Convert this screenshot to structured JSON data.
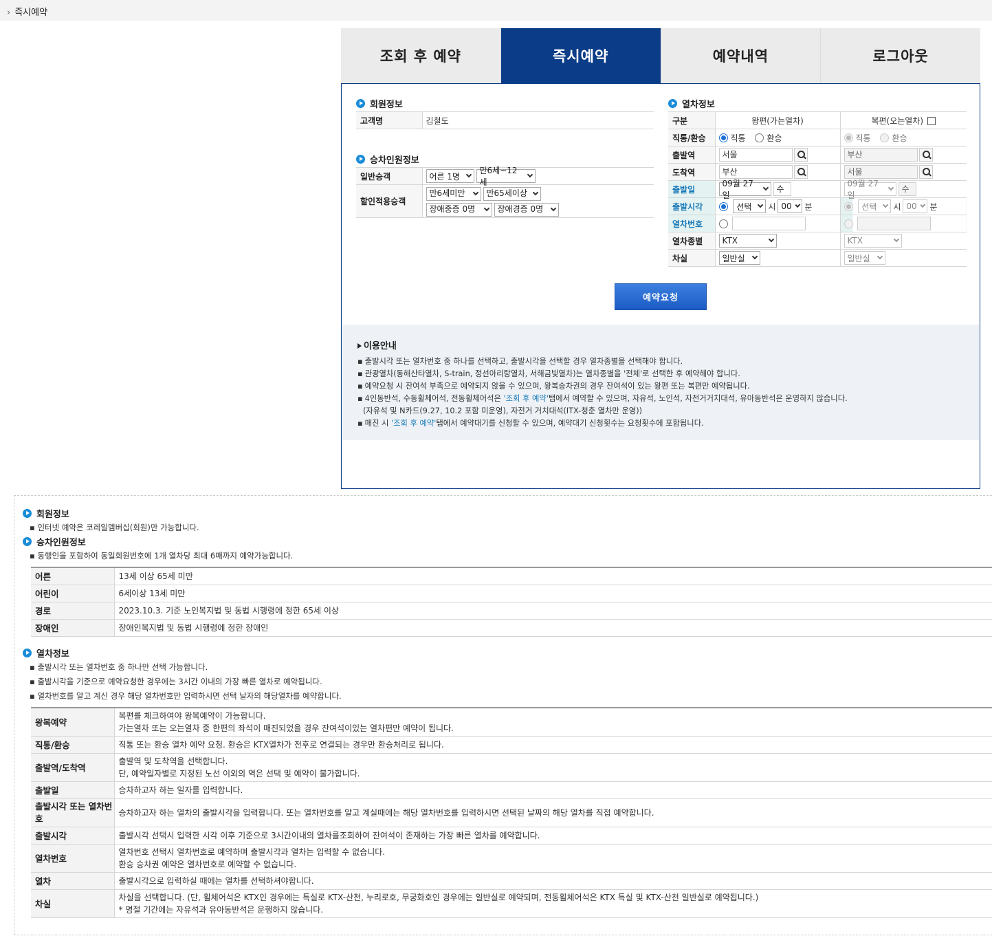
{
  "breadcrumb": {
    "label": "즉시예약"
  },
  "tabs": [
    "조회 후 예약",
    "즉시예약",
    "예약내역",
    "로그아웃"
  ],
  "member": {
    "title": "회원정보",
    "name_label": "고객명",
    "name_value": "김철도"
  },
  "passengers": {
    "title": "승차인원정보",
    "general_label": "일반승객",
    "general_adult": "어른 1명",
    "general_child": "만6세~12세",
    "discount_label": "할인적용승객",
    "disc_under6": "만6세미만",
    "disc_over65": "만65세이상",
    "disc_severe": "장애중증 0명",
    "disc_mild": "장애경증 0명"
  },
  "train": {
    "title": "열차정보",
    "col_label": "구분",
    "col_out": "왕편(가는열차)",
    "col_ret": "복편(오는열차)",
    "direct_label": "직통/환승",
    "direct": "직통",
    "transfer": "환승",
    "dep_label": "출발역",
    "arr_label": "도착역",
    "out_dep": "서울",
    "out_arr": "부산",
    "ret_dep": "부산",
    "ret_arr": "서울",
    "date_label": "출발일",
    "out_date": "09월 27일",
    "out_dow": "수",
    "ret_date": "09월 27일",
    "ret_dow": "수",
    "time_label": "출발시각",
    "time_sel": "선택",
    "hour_unit": "시",
    "min_sel": "00",
    "min_unit": "분",
    "trainno_label": "열차번호",
    "type_label": "열차종별",
    "type_value": "KTX",
    "car_label": "차실",
    "car_value": "일반실"
  },
  "request_button": "예약요청",
  "guide": {
    "title": "이용안내",
    "items": [
      "출발시각 또는 열차번호 중 하나를 선택하고, 출발시각을 선택할 경우 열차종별을 선택해야 합니다.",
      "관광열차(동해산타열차, S-train, 정선아리랑열차, 서해금빛열차)는 열차종별을 '전체'로 선택한 후 예약해야 합니다.",
      "예약요청 시 잔여석 부족으로 예약되지 않을 수 있으며, 왕복승차권의 경우 잔여석이 있는 왕편 또는 복편만 예약됩니다."
    ],
    "item4_pre": "4인동반석, 수동휠체어석, 전동휠체어석은 ",
    "item4_link": "'조회 후 예약'",
    "item4_post": "탭에서 예약할 수 있으며, 자유석, 노인석, 자전거거치대석, 유아동반석은 운영하지 않습니다.",
    "item4_line2": "(자유석 및 N카드(9.27, 10.2 포함 미운영), 자전거 거치대석(ITX-청춘 열차만 운영))",
    "item5_pre": "매진 시 ",
    "item5_link": "'조회 후 예약'",
    "item5_post": "탭에서 예약대기를 신청할 수 있으며, 예약대기 신청횟수는 요청횟수에 포함됩니다."
  },
  "help": {
    "member_title": "회원정보",
    "member_note": "인터넷 예약은 코레일멤버십(회원)만 가능합니다.",
    "pass_title": "승차인원정보",
    "pass_note": "동행인을 포함하여 동일회원번호에 1개 열차당 최대 6매까지 예약가능합니다.",
    "pass_rows": [
      {
        "k": "어른",
        "v": "13세 이상 65세 미만"
      },
      {
        "k": "어린이",
        "v": "6세이상 13세 미만"
      },
      {
        "k": "경로",
        "v": "2023.10.3. 기준 노인복지법 및 동법 시행령에 정한 65세 이상"
      },
      {
        "k": "장애인",
        "v": "장애인복지법 및 동법 시행령에 정한 장애인"
      }
    ],
    "train_title": "열차정보",
    "train_notes": [
      "출발시각 또는 열차번호 중 하나만 선택 가능합니다.",
      "출발시각을 기준으로 예약요청한 경우에는 3시간 이내의 가장 빠른 열차로 예약됩니다.",
      "열차번호를 알고 계신 경우 해당 열차번호만 입력하시면 선택 날자의 해당열차를 예약합니다."
    ],
    "train_rows": [
      {
        "k": "왕복예약",
        "v1": "복편를 체크하여야 왕복예약이 가능합니다.",
        "v2": "가는열차 또는 오는열차 중 한편의 좌석이 매진되었을 경우 잔여석이있는 열차편만 예약이 됩니다."
      },
      {
        "k": "직통/환승",
        "v1": "직통 또는 환승 열차 예약 요청. 환승은 KTX열차가 전후로 연결되는 경우만 환승처리로 됩니다.",
        "v2": ""
      },
      {
        "k": "출발역/도착역",
        "v1": "출발역 및 도착역을 선택합니다.",
        "v2": "단, 예약일자별로 지정된 노선 이외의 역은 선택 및 예약이 불가합니다."
      },
      {
        "k": "출발일",
        "v1": "승차하고자 하는 일자를 입력합니다.",
        "v2": ""
      },
      {
        "k": "출발시각 또는 열차번호",
        "v1": "승차하고자 하는 열차의 출발시각을 입력합니다. 또는 열차번호를 알고 계실때에는 해당 열차번호를 입력하시면 선택된 날짜의 해당 열차를 직접 예약합니다.",
        "v2": ""
      },
      {
        "k": "출발시각",
        "v1": "출발시각 선택시 입력한 시각 이후 기준으로 3시간이내의 열차를조회하여 잔여석이 존재하는 가장 빠른 열차를 예약합니다.",
        "v2": ""
      },
      {
        "k": "열차번호",
        "v1": "열차번호 선택시 열차번호로 예약하며 출발시각과 열차는 입력할 수 없습니다.",
        "v2": "환승 승차권 예약은 열차번호로 예약할 수 없습니다."
      },
      {
        "k": "열차",
        "v1": "출발시각으로 입력하실 때에는 열차를 선택하셔야합니다.",
        "v2": ""
      },
      {
        "k": "차실",
        "v1": "차실을 선택합니다. (단, 휠체어석은 KTX인 경우에는 특실로 KTX-산천, 누리로호, 무궁화호인 경우에는 일반실로 예약되며, 전동휠체어석은 KTX 특실 및 KTX-산천 일반실로 예약됩니다.)",
        "v2": "* 명절 기간에는 자유석과 유아동반석은 운행하지 않습니다."
      }
    ]
  }
}
